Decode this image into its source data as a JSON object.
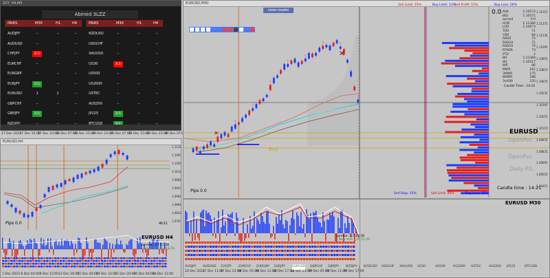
{
  "left_top": {
    "window_title": "ZZY_H4,M5",
    "scanner_title": "Abiroid 3LZZ",
    "headers_left": [
      "PAIRS",
      "M30",
      "H1",
      "H4"
    ],
    "headers_right": [
      "PAIRS",
      "M30",
      "H1",
      "H4"
    ],
    "rows_left": [
      {
        "pair": "AUDJPY",
        "m30": "--",
        "h1": "--",
        "h4": "--"
      },
      {
        "pair": "AUDUSD",
        "m30": "--",
        "h1": "--",
        "h4": "--"
      },
      {
        "pair": "CHFJPY",
        "m30": "3(1)",
        "h1": "--",
        "h4": "--"
      },
      {
        "pair": "EURCHF",
        "m30": "--",
        "h1": "--",
        "h4": "--"
      },
      {
        "pair": "EURGBP",
        "m30": "--",
        "h1": "--",
        "h4": "--"
      },
      {
        "pair": "EURJPY",
        "m30": "3(1)",
        "h1": "--",
        "h4": "--"
      },
      {
        "pair": "EURUSD",
        "m30": "3",
        "h1": "2",
        "h4": "--"
      },
      {
        "pair": "GBPCHF",
        "m30": "--",
        "h1": "--",
        "h4": "--"
      },
      {
        "pair": "GBPJPY",
        "m30": "3(1)",
        "h1": "--",
        "h4": "--"
      },
      {
        "pair": "NZDJPY",
        "m30": "--",
        "h1": "--",
        "h4": "--"
      }
    ],
    "rows_right": [
      {
        "pair": "NZDUSD",
        "m30": "--",
        "h1": "--",
        "h4": "--"
      },
      {
        "pair": "USDCHF",
        "m30": "--",
        "h1": "--",
        "h4": "--"
      },
      {
        "pair": "XAUUSD",
        "m30": "--",
        "h1": "--",
        "h4": "--"
      },
      {
        "pair": "US30",
        "m30": "3(1)",
        "h1": "--",
        "h4": "--"
      },
      {
        "pair": "US500",
        "m30": "--",
        "h1": "--",
        "h4": "--"
      },
      {
        "pair": "US2000",
        "m30": "--",
        "h1": "--",
        "h4": "--"
      },
      {
        "pair": "USTEC",
        "m30": "--",
        "h1": "--",
        "h4": "--"
      },
      {
        "pair": "AUS200",
        "m30": "--",
        "h1": "--",
        "h4": "--"
      },
      {
        "pair": "JP225",
        "m30": "3(1)",
        "h1": "--",
        "h4": "--"
      },
      {
        "pair": "BTCUSD",
        "m30": "3(1)",
        "h1": "--",
        "h4": "--"
      }
    ],
    "x_axis": [
      "27 Dec 2023",
      "27 Dec 15:00",
      "27 Dec 23:00",
      "28 Dec 07:00",
      "28 Dec 15:00",
      "28 Dec 23:00",
      "29 Dec 07:00",
      "29 Dec 15:00",
      "29 Dec 23:00",
      "30 Dec 07:00"
    ]
  },
  "left_bottom": {
    "window_title": "EURUSD,H4",
    "pips": "Pips 0.0",
    "time": "4h21",
    "symbol_label": "EURUSD H4",
    "london": "London : 17:15:36",
    "newyork": "* New York : 12:15:36",
    "y_axis": [
      "1.11385",
      "1.10930",
      "1.10560",
      "1.10185",
      "1.09810",
      "1.09435",
      "1.09060",
      "1.08685",
      "1.08310",
      "1.07935"
    ],
    "x_axis": [
      "1 Dec 2023",
      "6 Dec 04:00",
      "8 Dec 12:00",
      "12 Dec 20:00",
      "15 Dec 04:00",
      "19 Dec 12:00",
      "21 Dec 20:00",
      "26 Dec 04:00",
      "28 Dec 12:00"
    ]
  },
  "main": {
    "window_title": "EURUSD,M30",
    "news_label": "news reader",
    "buy_label": "Buy",
    "pips": "Pips 0.0",
    "sell_limit": "Sell Limit: 15%",
    "buy_limit": "Buy Limit: 13%",
    "sell_profit": "Sell Profit: 15%",
    "buy_loss": "Buy Loss: 26%",
    "sell_stop": "Sell Stop: 15%",
    "sell_limit2": "Sell Limit: 40%",
    "buy_loss2": "Buy Loss: 38%",
    "symbol_big": "EURUSD",
    "symbol_m30": "EURUSD M30",
    "open_pos": "OpenPos",
    "open_pos2": "OpenPos",
    "daily_pl": "Daily P/L",
    "candle_time": "Candle time : 14:21",
    "london": "London : 17:15:36",
    "newyork": "* New York : 12:15:36",
    "info_zero": "0.0",
    "info_rows": [
      [
        "ASK",
        "1.10572"
      ],
      [
        "BID",
        "1.10571"
      ],
      [
        "spread",
        "0.0"
      ],
      [
        "HOD",
        "1.11384"
      ],
      [
        "LOD",
        "1.10673"
      ],
      [
        "TDR",
        "71"
      ],
      [
        "YDR",
        "84"
      ],
      [
        "RAD5",
        "75"
      ],
      [
        "RAD10",
        "71"
      ],
      [
        "RAD20",
        "70"
      ],
      [
        "RTADR",
        "73"
      ],
      [
        "PTD",
        "2"
      ],
      [
        "BH",
        "1.11384"
      ],
      [
        "WL",
        "1.10517"
      ],
      [
        "WR",
        "86"
      ],
      [
        "MWR",
        "161"
      ],
      [
        "3MWR",
        "175"
      ],
      [
        "6MWR",
        "188"
      ],
      [
        "3xADR",
        "235"
      ]
    ],
    "candle_time_small": "Candle Time : 14:21",
    "y_axis": [
      "1.11515",
      "1.11375",
      "1.11235",
      "1.11095",
      "1.10955",
      "1.10815",
      "1.10675",
      "1.10535",
      "1.10395",
      "1.10255",
      "1.10115",
      "1.09975",
      "1.09835",
      "1.09695",
      "1.09555",
      "1.09415"
    ],
    "x_axis": [
      "22 Dec 2023",
      "27 Dec 11:00",
      "27 Dec 23:00",
      "28 Dec 05:00",
      "28 Dec 11:00",
      "28 Dec 17:00",
      "28 Dec 23:00",
      "29 Dec 05:00",
      "29 Dec 11:00",
      "29 Dec 17:00"
    ],
    "pair_tabs": [
      "AUDJPY",
      "AUDUSD",
      "CHFJPY",
      "EURCHF",
      "EURGBP",
      "EURJPY",
      "EURUSD",
      "GBPCHF",
      "GBPJPY",
      "NZDJPY",
      "NZDUSD",
      "USDCHF",
      "XAUUSD",
      "US30",
      "US500",
      "US2000",
      "USTEC",
      "AUS200",
      "JP225",
      "BTCUSD"
    ]
  },
  "colors": {
    "accent_red": "#ff0000",
    "accent_blue": "#0000ff",
    "green": "#1f9e2a",
    "gold": "#c8a800",
    "cyan": "#22d0d0"
  }
}
